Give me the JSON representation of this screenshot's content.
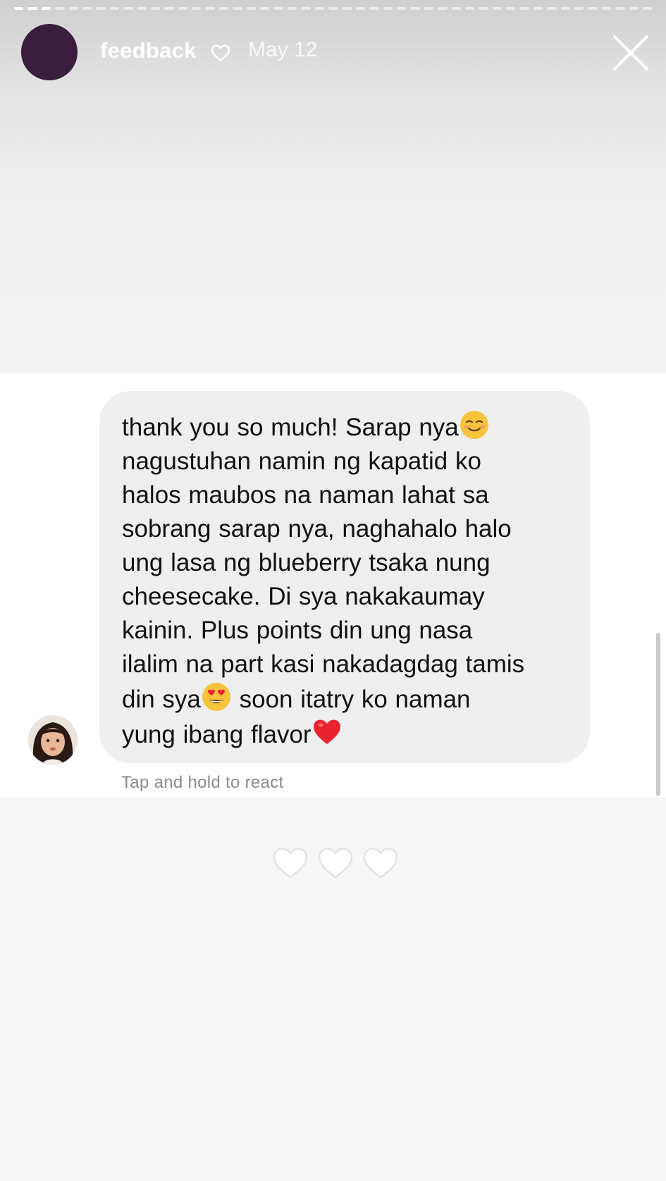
{
  "story": {
    "progress_segments": 47,
    "progress_done": 3
  },
  "header": {
    "username": "feedback",
    "date": "May 12",
    "heart_icon": "heart-outline-icon",
    "close_icon": "close-icon",
    "avatar_color": "#3a1c3c"
  },
  "message": {
    "line1": "thank you so much! Sarap nya",
    "line2": "nagustuhan namin ng kapatid ko",
    "line3": "halos maubos na naman lahat sa",
    "line4": "sobrang sarap nya, naghahalo halo",
    "line5": "ung lasa ng blueberry tsaka nung",
    "line6": "cheesecake. Di sya nakakaumay",
    "line7": "kainin. Plus points din ung nasa",
    "line8": "ilalim na part kasi nakadagdag tamis",
    "line9a": "din sya",
    "line9b": " soon itatry ko naman",
    "line10": "yung ibang flavor",
    "emoji1": "smiling-face-icon",
    "emoji2": "heart-eyes-icon",
    "emoji3": "red-heart-icon",
    "hint": "Tap and hold to react"
  },
  "reactions": [
    "heart-outline-icon",
    "heart-outline-icon",
    "heart-outline-icon"
  ],
  "colors": {
    "bubble": "#efefef",
    "hint": "#8a8a8a",
    "heart_red": "#e8232f"
  }
}
